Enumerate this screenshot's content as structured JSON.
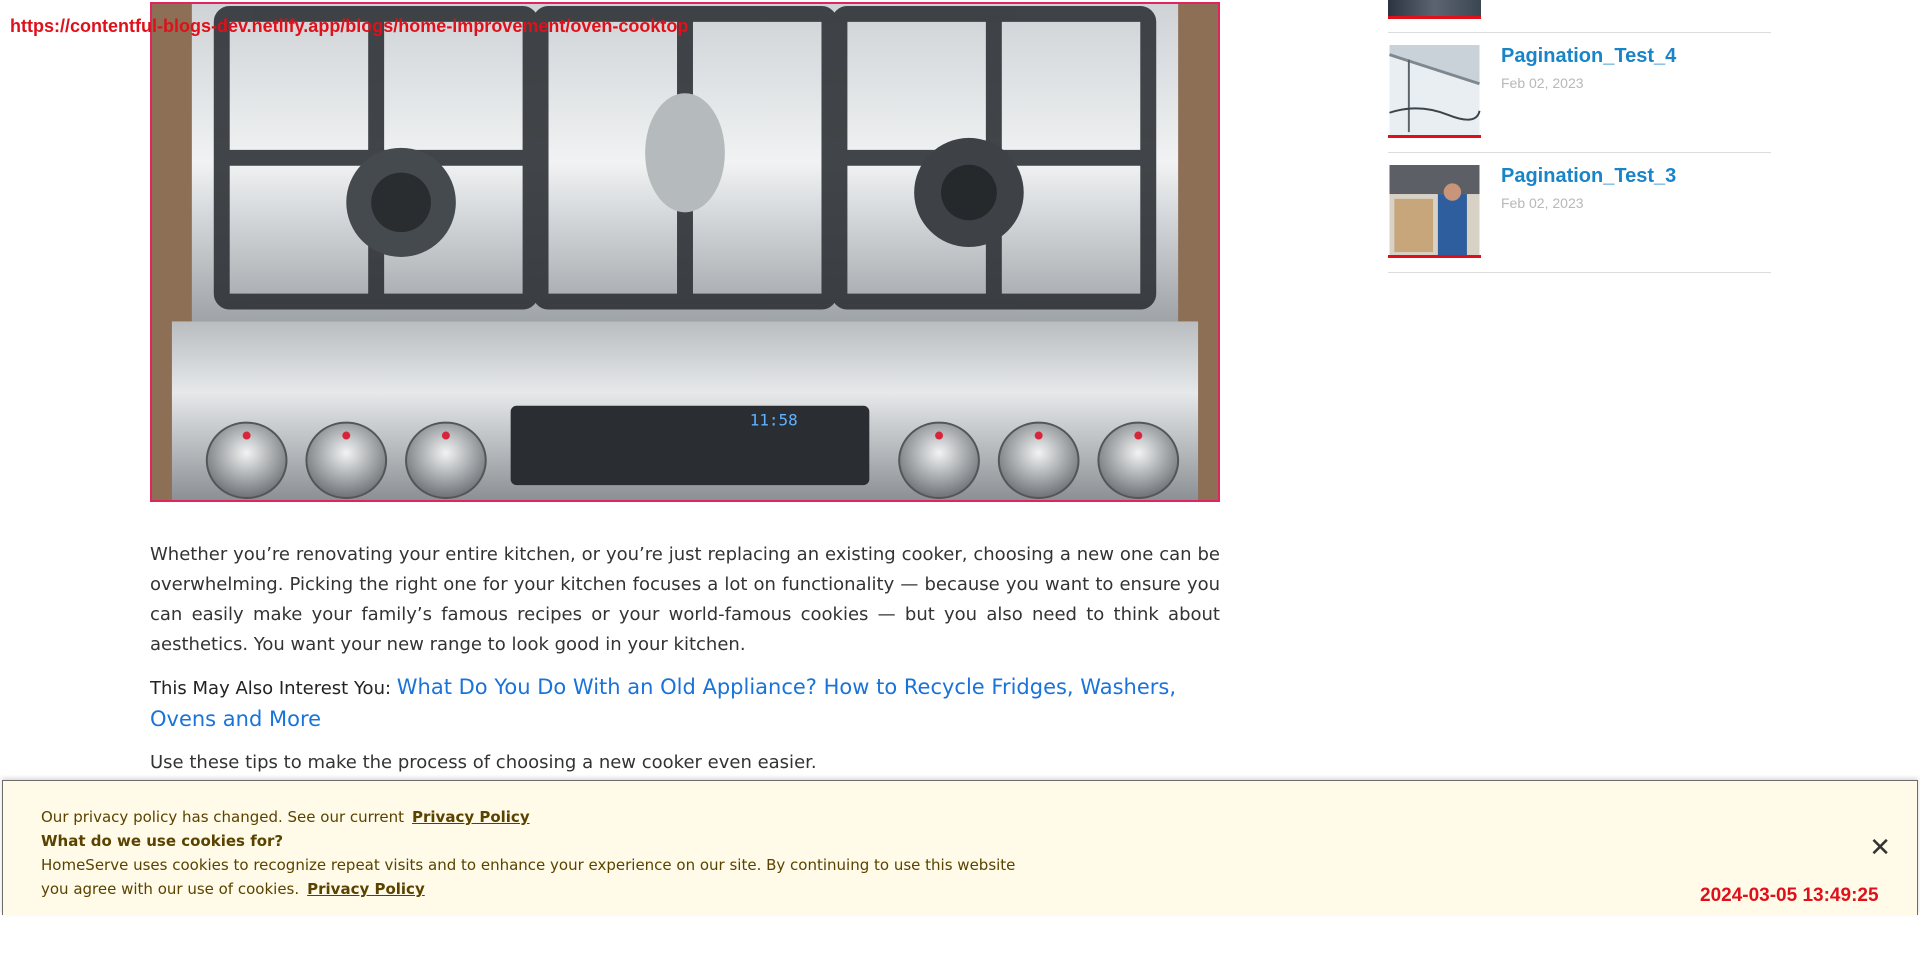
{
  "url_overlay": "https://contentful-blogs-dev.netlify.app/blogs/home-improvement/oven-cooktop",
  "hero": {
    "display_readout": "11:58"
  },
  "article": {
    "paragraph1": "Whether you’re renovating your entire kitchen, or you’re just replacing an existing cooker, choosing a new one can be overwhelming. Picking the right one for your kitchen focuses a lot on functionality — because you want to ensure you can easily make your family’s famous recipes or your world-famous cookies — but you also need to think about aesthetics. You want your new range to look good in your kitchen.",
    "interest_label": "This May Also Interest You:",
    "interest_link": "What Do You Do With an Old Appliance? How to Recycle Fridges, Washers, Ovens and More",
    "tips": "Use these tips to make the process of choosing a new cooker even easier."
  },
  "sidebar": {
    "items": [
      {
        "title": "Pagination_Test_4",
        "date": "Feb 02, 2023",
        "thumb_icon": "roof-gutter-photo-icon"
      },
      {
        "title": "Pagination_Test_3",
        "date": "Feb 02, 2023",
        "thumb_icon": "technician-photo-icon"
      }
    ]
  },
  "cookie": {
    "line1_text": "Our privacy policy has changed. See our current",
    "line1_link": "Privacy Policy",
    "heading": "What do we use cookies for?",
    "body": "HomeServe uses cookies to recognize repeat visits and to enhance your experience on our site. By continuing to use this website you agree with our use of cookies.",
    "body_link": "Privacy Policy",
    "close_label": "✕"
  },
  "timestamp": "2024-03-05 13:49:25",
  "colors": {
    "link_blue": "#1a73d9",
    "sidebar_title": "#1a84c8",
    "accent_red": "#e0101a",
    "cookie_bg": "#fffbe8"
  }
}
